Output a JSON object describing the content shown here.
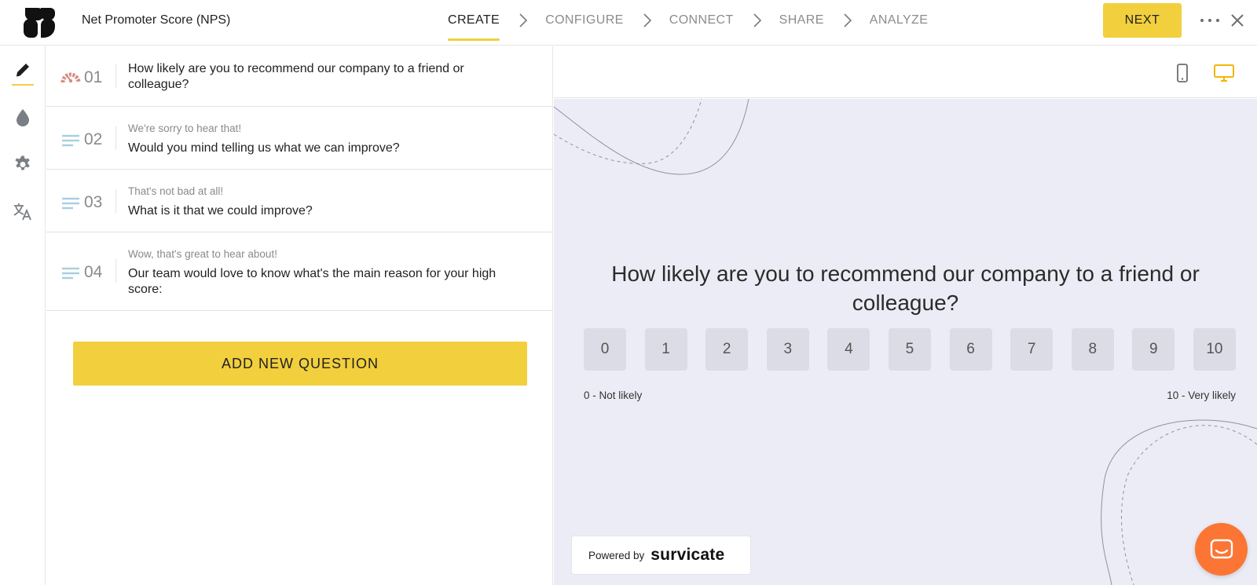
{
  "header": {
    "title": "Net Promoter Score (NPS)",
    "steps": [
      "CREATE",
      "CONFIGURE",
      "CONNECT",
      "SHARE",
      "ANALYZE"
    ],
    "active_step": "CREATE",
    "next_label": "NEXT"
  },
  "rail": {
    "items": [
      {
        "icon": "pencil-icon",
        "active": true
      },
      {
        "icon": "drop-icon",
        "active": false
      },
      {
        "icon": "gear-icon",
        "active": false
      },
      {
        "icon": "translate-icon",
        "active": false
      }
    ]
  },
  "questions": [
    {
      "num": "01",
      "icon": "nps-gauge-icon",
      "subtitle": "",
      "text": "How likely are you to recommend our company to a friend or colleague?"
    },
    {
      "num": "02",
      "icon": "text-lines-icon",
      "subtitle": "We're sorry to hear that!",
      "text": "Would you mind telling us what we can improve?"
    },
    {
      "num": "03",
      "icon": "text-lines-icon",
      "subtitle": "That's not bad at all!",
      "text": "What is it that we could improve?"
    },
    {
      "num": "04",
      "icon": "text-lines-icon",
      "subtitle": "Wow, that's great to hear about!",
      "text": "Our team would love to know what's the main reason for your high score:"
    }
  ],
  "add_question_label": "ADD NEW QUESTION",
  "preview": {
    "question": "How likely are you to recommend our company to a friend or colleague?",
    "scale": [
      "0",
      "1",
      "2",
      "3",
      "4",
      "5",
      "6",
      "7",
      "8",
      "9",
      "10"
    ],
    "label_low": "0 - Not likely",
    "label_high": "10 - Very likely",
    "powered_by": "Powered by",
    "brand": "survicate",
    "device_selected": "desktop"
  },
  "colors": {
    "accent": "#f2cf3d",
    "preview_bg": "#ececf6",
    "chat": "#fc7534",
    "nps_icon": "#d98a80",
    "text_icon": "#a9cfe0"
  }
}
